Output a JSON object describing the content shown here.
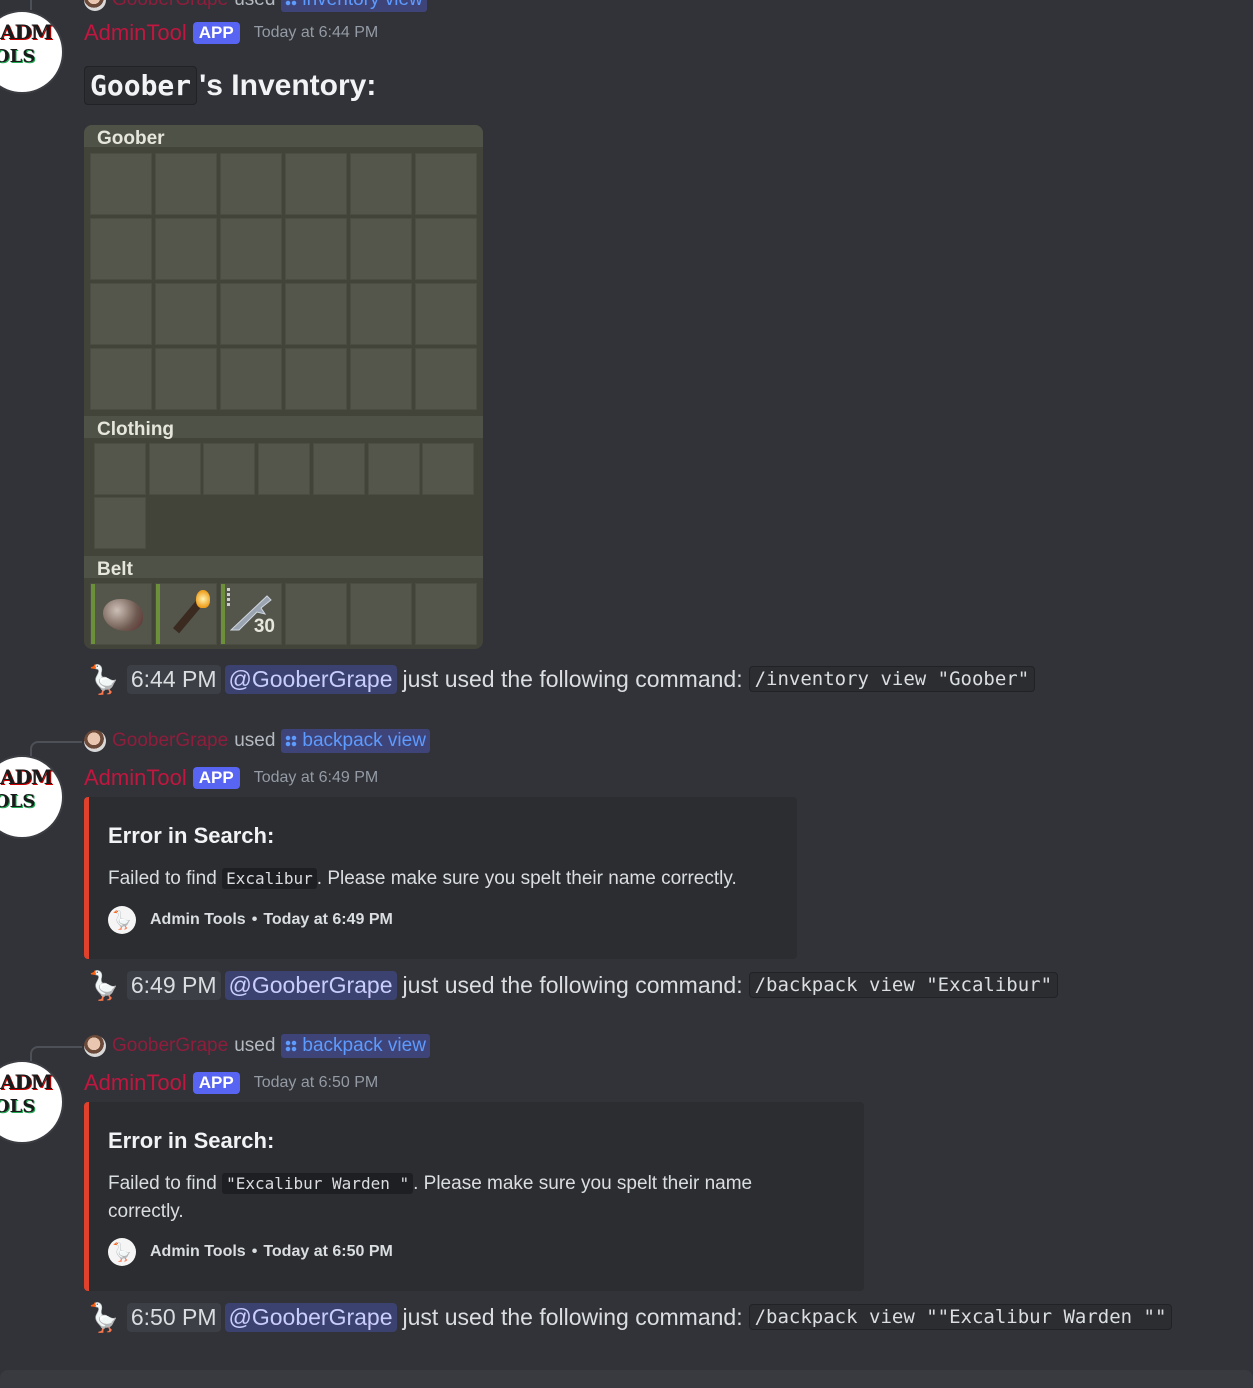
{
  "top_fragment": {
    "name": "GooberGrape",
    "used": "used",
    "command": "inventory view"
  },
  "messages": [
    {
      "author": "AdminTool",
      "tag": "APP",
      "time": "Today at 6:44 PM",
      "inventory_title_code": "Goober",
      "inventory_title_rest": "'s Inventory:",
      "inventory": {
        "main_label": "Goober",
        "clothing_label": "Clothing",
        "belt_label": "Belt",
        "belt_items": [
          "stone-item",
          "torch-item",
          "rifle-item"
        ],
        "rifle_ammo": "30"
      },
      "status": {
        "time": "6:44 PM",
        "mention": "@GooberGrape",
        "text": "just used the following command:",
        "command": "/inventory view \"Goober\""
      }
    },
    {
      "reply": {
        "name": "GooberGrape",
        "used": "used",
        "command": "backpack view"
      },
      "author": "AdminTool",
      "tag": "APP",
      "time": "Today at 6:49 PM",
      "embed": {
        "title": "Error in Search:",
        "desc_before": "Failed to find",
        "desc_code": "Excalibur",
        "desc_after": ". Please make sure you spelt their name correctly.",
        "footer_name": "Admin Tools",
        "footer_sep": "•",
        "footer_time": "Today at 6:49 PM",
        "accent": "#e0412c"
      },
      "status": {
        "time": "6:49 PM",
        "mention": "@GooberGrape",
        "text": "just used the following command:",
        "command": "/backpack view \"Excalibur\""
      }
    },
    {
      "reply": {
        "name": "GooberGrape",
        "used": "used",
        "command": "backpack view"
      },
      "author": "AdminTool",
      "tag": "APP",
      "time": "Today at 6:50 PM",
      "embed": {
        "title": "Error in Search:",
        "desc_before": "Failed to find",
        "desc_code": "\"Excalibur Warden \"",
        "desc_after": ". Please make sure you spelt their name",
        "desc_line2": "correctly.",
        "footer_name": "Admin Tools",
        "footer_sep": "•",
        "footer_time": "Today at 6:50 PM",
        "accent": "#e0412c"
      },
      "status": {
        "time": "6:50 PM",
        "mention": "@GooberGrape",
        "text": "just used the following command:",
        "command": "/backpack view \"\"Excalibur Warden \"\""
      }
    }
  ],
  "avatar": {
    "line1": "ADM",
    "line2": "OLS"
  },
  "colors": {
    "background": "#313338",
    "author": "#c1163f",
    "app_tag": "#5865f2",
    "mention": "#c9cdfb",
    "link": "#5d9bff"
  }
}
